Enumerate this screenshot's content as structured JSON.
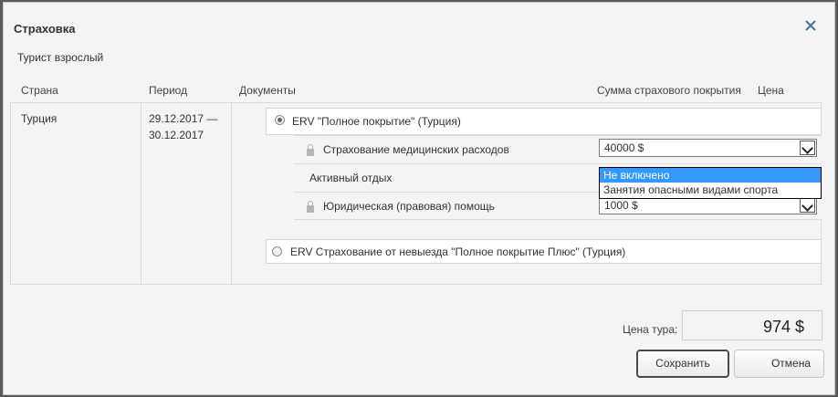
{
  "dialog": {
    "title": "Страховка",
    "tourist": "Турист взрослый"
  },
  "table": {
    "headers": {
      "country": "Страна",
      "period": "Период",
      "documents": "Документы",
      "coverage": "Сумма страхового покрытия",
      "price": "Цена"
    },
    "row": {
      "country": "Турция",
      "period_line1": "29.12.2017 —",
      "period_line2": "30.12.2017"
    }
  },
  "insurance": {
    "option1": {
      "label": "ERV \"Полное покрытие\" (Турция)",
      "selected": true,
      "items": [
        {
          "label": "Страхование медицинских расходов",
          "locked": true,
          "value": "40000 $"
        },
        {
          "label": "Активный отдых",
          "locked": false,
          "value": "Не включено"
        },
        {
          "label": "Юридическая (правовая) помощь",
          "locked": true,
          "value": "1000 $"
        }
      ]
    },
    "option2": {
      "label": "ERV Страхование от невыезда \"Полное покрытие Плюс\" (Турция)",
      "selected": false
    }
  },
  "dropdown": {
    "options": [
      "Не включено",
      "Занятия опасными видами спорта"
    ],
    "highlighted_index": 0
  },
  "footer": {
    "price_label": "Цена тура:",
    "price_value": "974 $",
    "save_label": "Сохранить",
    "cancel_label": "Отмена"
  },
  "colors": {
    "accent": "#3b6e9c",
    "highlight": "#3399ff"
  }
}
